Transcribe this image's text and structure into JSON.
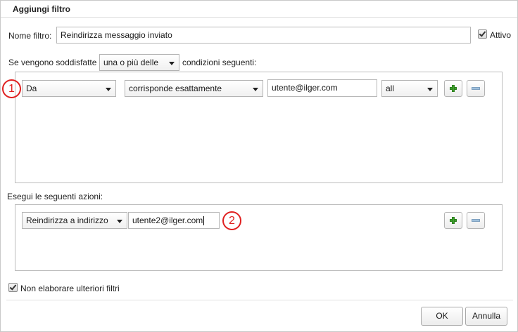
{
  "dialog": {
    "title": "Aggiungi filtro",
    "name_label": "Nome filtro:",
    "name_value": "Reindirizza messaggio inviato",
    "active_label": "Attivo",
    "active_checked": true
  },
  "conditions": {
    "prefix": "Se vengono soddisfatte",
    "match_select": "una o più delle",
    "suffix": "condizioni seguenti:",
    "rows": [
      {
        "field": "Da",
        "operator": "corrisponde esattamente",
        "value": "utente@ilger.com",
        "scope": "all"
      }
    ]
  },
  "actions": {
    "label": "Esegui le seguenti azioni:",
    "rows": [
      {
        "action": "Reindirizza a indirizzo",
        "value": "utente2@ilger.com"
      }
    ]
  },
  "options": {
    "stop_label": "Non elaborare ulteriori filtri",
    "stop_checked": true
  },
  "buttons": {
    "ok": "OK",
    "cancel": "Annulla"
  },
  "markers": {
    "first": "1",
    "second": "2"
  },
  "colors": {
    "marker": "#e02020",
    "add": "#3ea22c",
    "remove": "#9fc0dc"
  },
  "icons": {
    "add": "plus-icon",
    "remove": "minus-icon",
    "dropdown": "chevron-down-icon",
    "check": "checkmark-icon"
  }
}
